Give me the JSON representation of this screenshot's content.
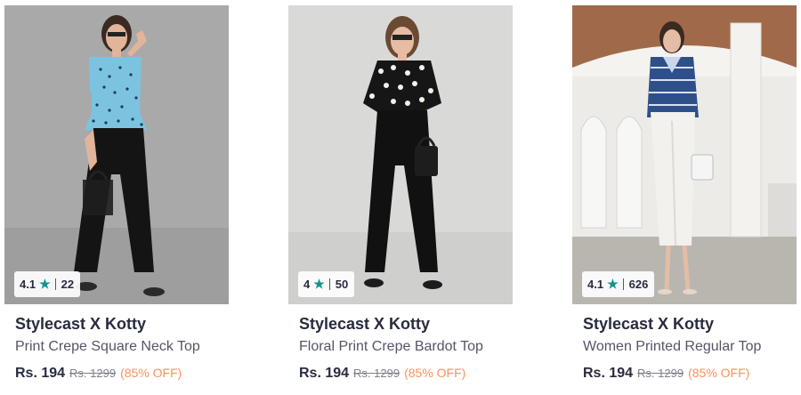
{
  "products": [
    {
      "brand": "Stylecast X Kotty",
      "name": "Print Crepe Square Neck Top",
      "price": "Rs. 194",
      "mrp": "Rs. 1299",
      "discount": "(85% OFF)",
      "rating": "4.1",
      "rating_count": "22"
    },
    {
      "brand": "Stylecast X Kotty",
      "name": "Floral Print Crepe Bardot Top",
      "price": "Rs. 194",
      "mrp": "Rs. 1299",
      "discount": "(85% OFF)",
      "rating": "4",
      "rating_count": "50"
    },
    {
      "brand": "Stylecast X Kotty",
      "name": "Women Printed Regular Top",
      "price": "Rs. 194",
      "mrp": "Rs. 1299",
      "discount": "(85% OFF)",
      "rating": "4.1",
      "rating_count": "626"
    }
  ],
  "icons": {
    "rating": "star-icon",
    "star_color": "#14958f"
  },
  "colors": {
    "discount": "#ff905a",
    "brand": "#282c3f",
    "name": "#535766",
    "mrp": "#7e818c"
  }
}
